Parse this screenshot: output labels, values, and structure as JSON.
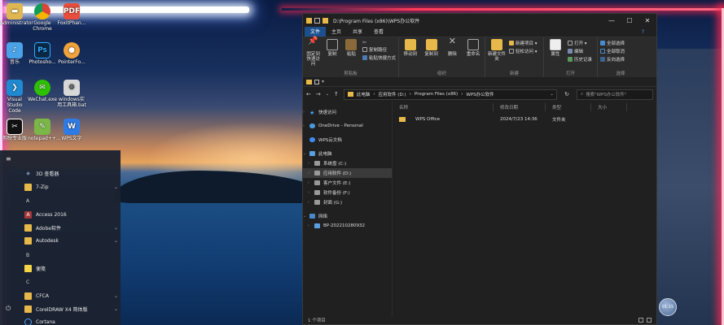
{
  "desktop": {
    "icons": [
      {
        "label": "Administrator",
        "name": "administrator"
      },
      {
        "label": "Google Chrome",
        "name": "google-chrome"
      },
      {
        "label": "FoxitPhan...",
        "name": "foxit-phantom"
      },
      {
        "label": "音乐",
        "name": "music"
      },
      {
        "label": "Photosho...",
        "name": "photoshop"
      },
      {
        "label": "PointerFo...",
        "name": "pointerfocus"
      },
      {
        "label": "Visual Studio Code",
        "name": "vscode"
      },
      {
        "label": "WeChat.exe",
        "name": "wechat"
      },
      {
        "label": "windows实用工具箱.bat",
        "name": "windows-toolbox"
      },
      {
        "label": "剪映专业版",
        "name": "jianying"
      },
      {
        "label": "notepad++...",
        "name": "notepad-plus-plus"
      },
      {
        "label": "WPS文字",
        "name": "wps-writer"
      }
    ]
  },
  "start_menu": {
    "items": [
      {
        "label": "3D 查看器",
        "chev": ""
      },
      {
        "label": "7-Zip",
        "chev": "⌄"
      },
      {
        "letter": "A"
      },
      {
        "label": "Access 2016",
        "chev": ""
      },
      {
        "label": "Adobe软件",
        "chev": "⌄"
      },
      {
        "label": "Autodesk",
        "chev": "⌄"
      },
      {
        "letter": "B"
      },
      {
        "label": "便笺",
        "chev": ""
      },
      {
        "letter": "C"
      },
      {
        "label": "CFCA",
        "chev": "⌄"
      },
      {
        "label": "CorelDRAW X4 简体版",
        "chev": "⌄"
      },
      {
        "label": "Cortana",
        "chev": ""
      }
    ]
  },
  "explorer": {
    "title": "D:\\Program Files (x86)\\WPS办公软件",
    "window_controls": [
      "—",
      "☐",
      "✕"
    ],
    "ribbon_tabs": [
      "文件",
      "主页",
      "共享",
      "查看"
    ],
    "help_icon": "?",
    "ribbon": {
      "clipboard": {
        "pin_label": "固定到快速访问",
        "copy_label": "复制",
        "paste_label": "粘贴",
        "copy_path": "复制路径",
        "paste_shortcut": "粘贴快捷方式",
        "group": "剪贴板"
      },
      "organize": {
        "move_to": "移动到",
        "copy_to": "复制到",
        "delete": "删除",
        "rename": "重命名",
        "group": "组织"
      },
      "new": {
        "new_folder": "新建文件夹",
        "new_item": "新建项目 ▾",
        "easy_access": "轻松访问 ▾",
        "group": "新建"
      },
      "open": {
        "properties": "属性",
        "open": "打开 ▾",
        "edit": "编辑",
        "history": "历史记录",
        "group": "打开"
      },
      "select": {
        "select_all": "全部选择",
        "select_none": "全部取消",
        "invert": "反向选择",
        "group": "选择"
      }
    },
    "address": {
      "crumbs": [
        "此电脑",
        "›",
        "应用软件 (D:)",
        "›",
        "Program Files (x86)",
        "›",
        "WPS办公软件"
      ],
      "dropdown": "⌄",
      "search_placeholder": "搜索\"WPS办公软件\""
    },
    "nav_pane": {
      "quick_access": "快速访问",
      "onedrive": "OneDrive - Personal",
      "wps_cloud": "WPS云文档",
      "this_pc": "此电脑",
      "drives": [
        "系统盘 (C:)",
        "应用软件 (D:)",
        "客户文件 (E:)",
        "软件备份 (F:)",
        "封面 (G:)"
      ],
      "network": "网络",
      "network_pc": "BP-202210280932"
    },
    "columns": [
      "名称",
      "修改日期",
      "类型",
      "大小"
    ],
    "files": [
      {
        "name": "WPS Office",
        "date": "2024/7/23 14:36",
        "type": "文件夹",
        "size": ""
      }
    ],
    "status": "1 个项目"
  },
  "float_ball": "01:15"
}
